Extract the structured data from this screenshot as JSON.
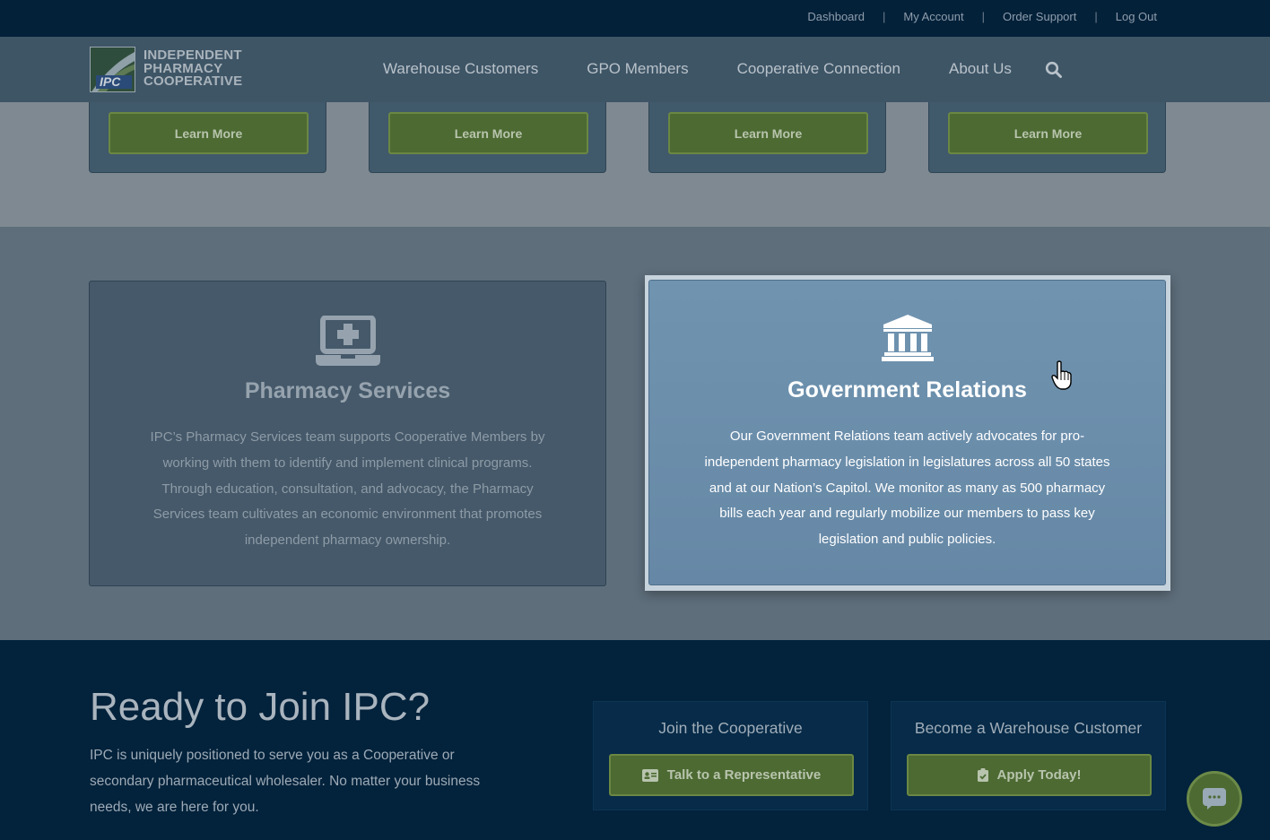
{
  "topbar": {
    "links": [
      {
        "label": "Dashboard"
      },
      {
        "label": "My Account"
      },
      {
        "label": "Order Support"
      },
      {
        "label": "Log Out"
      }
    ],
    "separator": "|"
  },
  "nav": {
    "logo": {
      "mark": "IPC",
      "line1": "INDEPENDENT",
      "line2": "PHARMACY",
      "line3": "COOPERATIVE"
    },
    "items": [
      {
        "label": "Warehouse Customers"
      },
      {
        "label": "GPO Members"
      },
      {
        "label": "Cooperative Connection"
      },
      {
        "label": "About Us"
      }
    ],
    "search_icon": "search-icon"
  },
  "cards_row": {
    "buttons": [
      {
        "label": "Learn More"
      },
      {
        "label": "Learn More"
      },
      {
        "label": "Learn More"
      },
      {
        "label": "Learn More"
      }
    ]
  },
  "services": {
    "pharmacy": {
      "icon": "laptop-medical-icon",
      "title": "Pharmacy Services",
      "body": "IPC’s Pharmacy Services team supports Cooperative Members by working with them to identify and implement clinical programs. Through education, consultation, and advocacy, the Pharmacy Services team cultivates an economic environment that promotes independent pharmacy ownership."
    },
    "government": {
      "icon": "landmark-icon",
      "title": "Government Relations",
      "body": "Our Government Relations team actively advocates for pro-independent pharmacy legislation in legislatures across all 50 states and at our Nation’s Capitol. We monitor as many as 500 pharmacy bills each year and regularly mobilize our members to pass key legislation and public policies."
    }
  },
  "cta": {
    "title": "Ready to Join IPC?",
    "body": "IPC is uniquely positioned to serve you as a Cooperative or secondary pharmaceutical wholesaler. No matter your business needs, we are here for you.",
    "join": {
      "label": "Join the Cooperative",
      "button": "Talk to a Representative",
      "icon": "id-card-icon"
    },
    "warehouse": {
      "label": "Become a Warehouse Customer",
      "button": "Apply Today!",
      "icon": "clipboard-check-icon"
    }
  },
  "chat": {
    "icon": "chat-icon"
  },
  "colors": {
    "navy": "#03223b",
    "green": "#4c6a32",
    "highlight": "#6e91ad"
  }
}
